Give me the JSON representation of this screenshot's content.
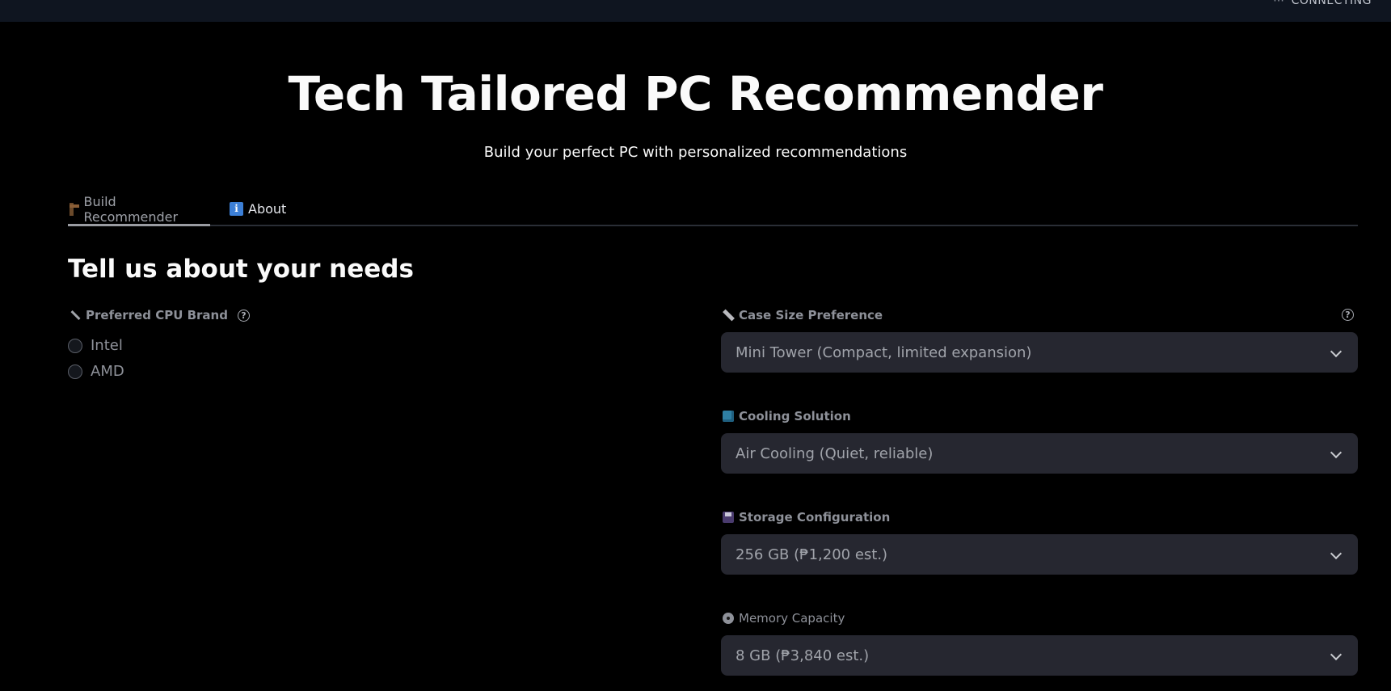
{
  "status": {
    "text": "CONNECTING"
  },
  "header": {
    "title": "Tech Tailored PC Recommender",
    "subtitle": "Build your perfect PC with personalized recommendations"
  },
  "tabs": [
    {
      "label": "Build Recommender",
      "icon": "build-icon",
      "active": true
    },
    {
      "label": "About",
      "icon": "info-icon",
      "active": false
    }
  ],
  "main": {
    "heading": "Tell us about your needs",
    "cpu_brand": {
      "label": "Preferred CPU Brand",
      "icon": "wrench-icon",
      "options": [
        "Intel",
        "AMD"
      ]
    },
    "case_size": {
      "label": "Case Size Preference",
      "icon": "ruler-icon",
      "value": "Mini Tower (Compact, limited expansion)"
    },
    "cooling": {
      "label": "Cooling Solution",
      "icon": "cube-icon",
      "value": "Air Cooling (Quiet, reliable)"
    },
    "storage": {
      "label": "Storage Configuration",
      "icon": "floppy-disk-icon",
      "value": "256 GB (₱1,200 est.)"
    },
    "memory": {
      "label": "Memory Capacity",
      "icon": "disc-icon",
      "value": "8 GB (₱3,840 est.)"
    }
  },
  "colors": {
    "background": "#000000",
    "topbar": "#0f1520",
    "select_bg": "#262730",
    "muted_text": "#8e9199"
  }
}
